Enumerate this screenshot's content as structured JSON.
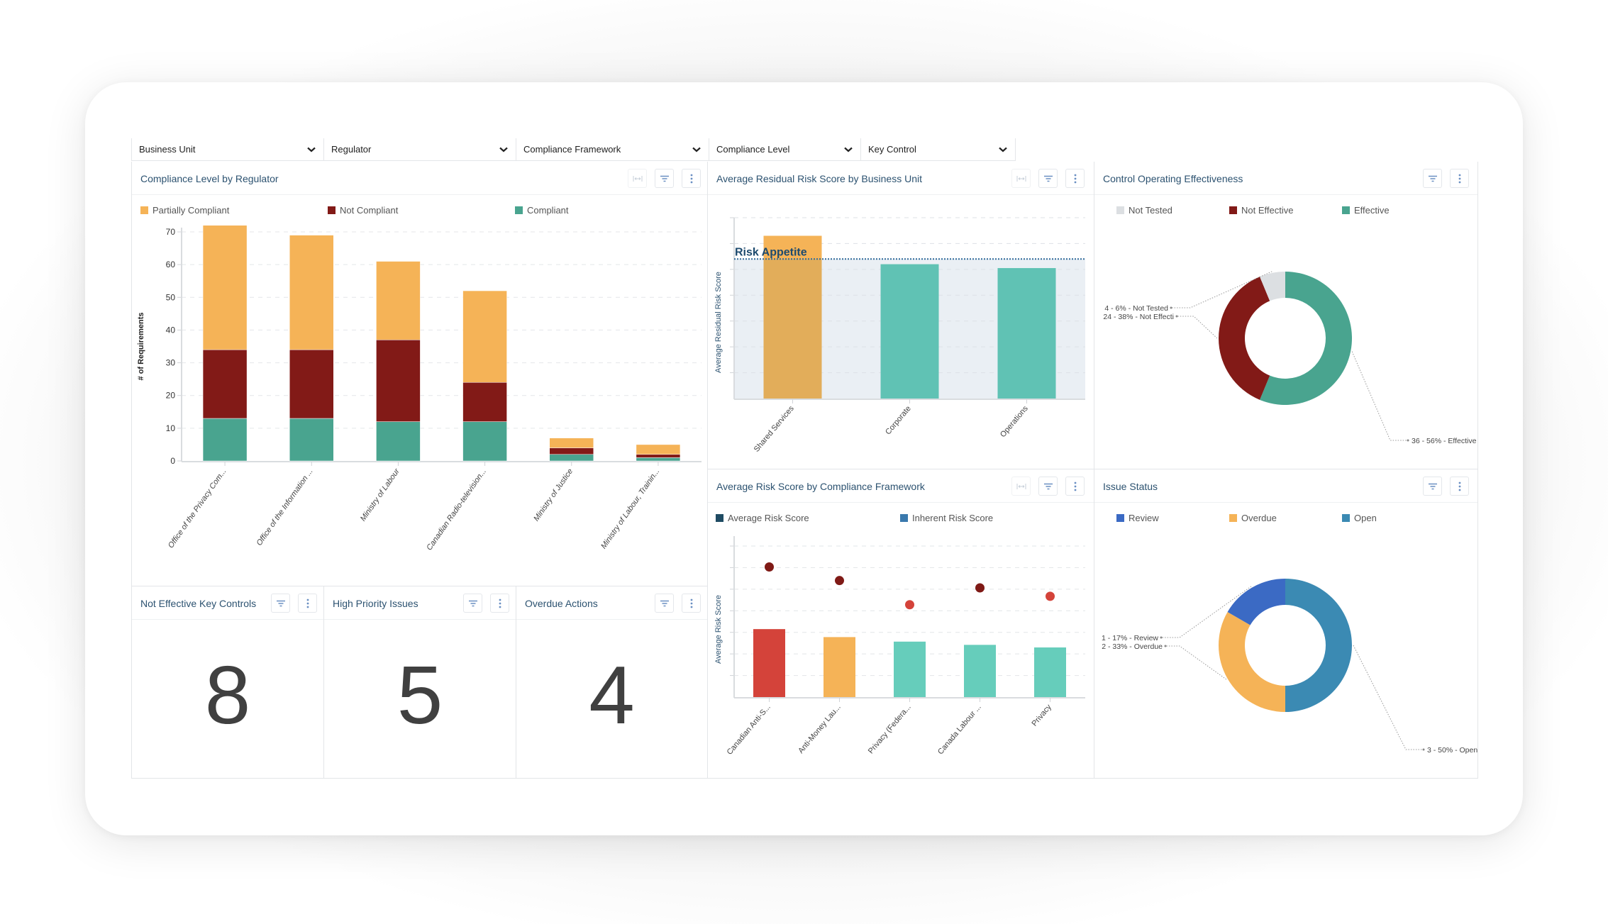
{
  "filters": [
    {
      "label": "Business Unit"
    },
    {
      "label": "Regulator"
    },
    {
      "label": "Compliance Framework"
    },
    {
      "label": "Compliance Level"
    },
    {
      "label": "Key Control"
    }
  ],
  "widgets": {
    "compliance_by_regulator": {
      "title": "Compliance Level by Regulator"
    },
    "residual_risk": {
      "title": "Average Residual Risk Score by Business Unit"
    },
    "control_effectiveness": {
      "title": "Control Operating Effectiveness"
    },
    "risk_by_framework": {
      "title": "Average Risk Score by Compliance Framework"
    },
    "issue_status": {
      "title": "Issue Status"
    },
    "kpis": [
      {
        "title": "Not Effective Key Controls",
        "value": "8"
      },
      {
        "title": "High Priority Issues",
        "value": "5"
      },
      {
        "title": "Overdue Actions",
        "value": "4"
      }
    ]
  },
  "icons": {
    "expand": "expand-width-icon",
    "filter": "filter-icon",
    "more": "more-vertical-icon",
    "dropdown": "chevron-down-icon"
  },
  "colors": {
    "partially_compliant": "#f5b357",
    "not_compliant": "#821a17",
    "compliant": "#49a48f",
    "teal_bar": "#60c2b4",
    "orange_bar": "#e2ad5a",
    "risk_appetite": "#1d4a6e",
    "not_tested": "#dcdfe2",
    "review": "#3b6ac4",
    "overdue": "#f5b357",
    "open": "#3b8ab3",
    "dot_dark": "#7f1a16",
    "dot_red": "#d4433a",
    "bar_red": "#d4433a",
    "title": "#2c5270"
  },
  "chart_data": [
    {
      "id": "compliance_by_regulator",
      "type": "bar",
      "stacked": true,
      "title": "Compliance Level by Regulator",
      "xlabel": "",
      "ylabel": "# of Requirements",
      "ylim": [
        0,
        70
      ],
      "yticks": [
        0,
        10,
        20,
        30,
        40,
        50,
        60,
        70
      ],
      "grid": true,
      "legend_position": "top",
      "categories": [
        "Office of the Privacy Com...",
        "Office of the Information ...",
        "Ministry of Labour",
        "Canadian Radio-television...",
        "Ministry of Justice",
        "Ministry of Labour, Trainin..."
      ],
      "series": [
        {
          "name": "Compliant",
          "color": "#49a48f",
          "values": [
            13,
            13,
            12,
            12,
            2,
            1
          ]
        },
        {
          "name": "Not Compliant",
          "color": "#821a17",
          "values": [
            21,
            21,
            25,
            12,
            2,
            1
          ]
        },
        {
          "name": "Partially Compliant",
          "color": "#f5b357",
          "values": [
            38,
            35,
            24,
            28,
            3,
            3
          ]
        }
      ],
      "legend": [
        "Partially Compliant",
        "Not Compliant",
        "Compliant"
      ]
    },
    {
      "id": "residual_risk",
      "type": "bar",
      "title": "Average Residual Risk Score by Business Unit",
      "xlabel": "",
      "ylabel": "Average Residual Risk Score",
      "ylim": [
        0,
        7
      ],
      "grid": true,
      "categories": [
        "Shared Services",
        "Corporate",
        "Operations"
      ],
      "values": [
        6.3,
        5.2,
        5.05
      ],
      "colors": [
        "#e2ad5a",
        "#60c2b4",
        "#60c2b4"
      ],
      "annotations": [
        {
          "type": "threshold",
          "label": "Risk Appetite",
          "value": 5.4
        }
      ]
    },
    {
      "id": "control_effectiveness",
      "type": "pie",
      "donut": true,
      "title": "Control Operating Effectiveness",
      "legend": [
        "Not Tested",
        "Not Effective",
        "Effective"
      ],
      "slices": [
        {
          "name": "Effective",
          "value": 36,
          "percent": 56,
          "color": "#49a48f",
          "label": "36 - 56% - Effective"
        },
        {
          "name": "Not Effective",
          "value": 24,
          "percent": 38,
          "color": "#821a17",
          "label": "24 - 38% - Not Effecti"
        },
        {
          "name": "Not Tested",
          "value": 4,
          "percent": 6,
          "color": "#dcdfe2",
          "label": "4 - 6% - Not Tested"
        }
      ]
    },
    {
      "id": "risk_by_framework",
      "type": "bar",
      "title": "Average Risk Score by Compliance Framework",
      "xlabel": "",
      "ylabel": "Average Risk Score",
      "ylim": [
        0,
        7
      ],
      "grid": true,
      "legend": [
        "Average Risk Score",
        "Inherent Risk Score"
      ],
      "legend_colors": [
        "#1f4b63",
        "#3a79ad"
      ],
      "categories": [
        "Canadian Anti-S...",
        "Anti-Money Lau...",
        "Privacy (Federa...",
        "Canada Labour ...",
        "Privacy"
      ],
      "series": [
        {
          "name": "Average Risk Score",
          "type": "bar",
          "values": [
            3.15,
            2.78,
            2.57,
            2.42,
            2.3
          ],
          "colors": [
            "#d4433a",
            "#f5b357",
            "#66cdbb",
            "#66cdbb",
            "#66cdbb"
          ]
        },
        {
          "name": "Inherent Risk Score",
          "type": "scatter",
          "values": [
            6.03,
            5.4,
            4.28,
            5.06,
            4.67
          ],
          "colors": [
            "#7f1a16",
            "#7f1a16",
            "#d4433a",
            "#7f1a16",
            "#d4433a"
          ]
        }
      ]
    },
    {
      "id": "issue_status",
      "type": "pie",
      "donut": true,
      "title": "Issue Status",
      "legend": [
        "Review",
        "Overdue",
        "Open"
      ],
      "slices": [
        {
          "name": "Open",
          "value": 3,
          "percent": 50,
          "color": "#3b8ab3",
          "label": "3 - 50% - Open"
        },
        {
          "name": "Overdue",
          "value": 2,
          "percent": 33,
          "color": "#f5b357",
          "label": "2 - 33% - Overdue"
        },
        {
          "name": "Review",
          "value": 1,
          "percent": 17,
          "color": "#3b6ac4",
          "label": "1 - 17% - Review"
        }
      ]
    }
  ]
}
